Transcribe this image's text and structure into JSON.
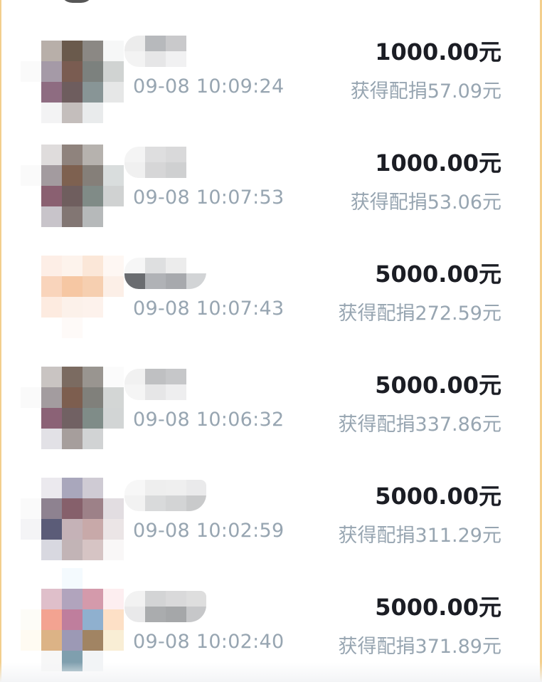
{
  "donations": [
    {
      "time": "09-08 10:09:24",
      "amount": "1000.00元",
      "match": "获得配捐57.09元",
      "avatar_colors": [
        "#ffffff",
        "#ffffff",
        "#ffffff",
        "#ffffff",
        "#ffffff",
        "#ffffff",
        "#b8afa9",
        "#6a5a4c",
        "#8b8884",
        "#f6f7f7",
        "#fafafa",
        "#a59aa7",
        "#7a5c51",
        "#7c817e",
        "#d0d3d2",
        "#ffffff",
        "#8e6c81",
        "#6e5d5e",
        "#889596",
        "#e6e7e7",
        "#ffffff",
        "#f3f3f4",
        "#c4bebc",
        "#e9ebec",
        "#ffffff"
      ],
      "name_colors": [
        "#ececec",
        "#b7b9bc",
        "#c9c9cb",
        "#ffffff",
        "#f3f3f3",
        "#e6e6e7",
        "#f1f1f2",
        "#ffffff"
      ]
    },
    {
      "time": "09-08 10:07:53",
      "amount": "1000.00元",
      "match": "获得配捐53.06元",
      "avatar_colors": [
        "#ffffff",
        "#ffffff",
        "#ffffff",
        "#ffffff",
        "#ffffff",
        "#ffffff",
        "#dfdcdc",
        "#8f837d",
        "#b6b2ae",
        "#ffffff",
        "#fafafa",
        "#a39b9f",
        "#7e6150",
        "#857f79",
        "#d9dddd",
        "#ffffff",
        "#8a6071",
        "#6f5e5e",
        "#808b87",
        "#d0d2d2",
        "#ffffff",
        "#c8c4ca",
        "#827673",
        "#b6b9ba",
        "#ffffff"
      ],
      "name_colors": [
        "#f4f4f4",
        "#dededf",
        "#d9d9da",
        "#ffffff",
        "#f0f0f0",
        "#d6d6d7",
        "#cfd0d1",
        "#ffffff"
      ]
    },
    {
      "time": "09-08 10:07:43",
      "amount": "5000.00元",
      "match": "获得配捐272.59元",
      "avatar_colors": [
        "#ffffff",
        "#ffffff",
        "#ffffff",
        "#ffffff",
        "#ffffff",
        "#ffffff",
        "#fdeee6",
        "#fdf3ec",
        "#fbe7d8",
        "#fef7f3",
        "#ffffff",
        "#f9d4bb",
        "#f6c7a3",
        "#f6cfb0",
        "#fcefe7",
        "#ffffff",
        "#fdebe0",
        "#fcf1ea",
        "#fdf2ec",
        "#ffffff",
        "#ffffff",
        "#ffffff",
        "#fefaf8",
        "#ffffff",
        "#ffffff"
      ],
      "name_colors": [
        "#f6f6f6",
        "#dedfe0",
        "#ececec",
        "#ffffff",
        "#6a6c70",
        "#b0b2b6",
        "#a7a9ad",
        "#d2d4d6"
      ]
    },
    {
      "time": "09-08 10:06:32",
      "amount": "5000.00元",
      "match": "获得配捐337.86元",
      "avatar_colors": [
        "#ffffff",
        "#ffffff",
        "#ffffff",
        "#ffffff",
        "#ffffff",
        "#ffffff",
        "#c9c4c2",
        "#7b6b61",
        "#999590",
        "#fbfbfb",
        "#fafafa",
        "#a39c9f",
        "#7d5e4f",
        "#80807b",
        "#d3d6d5",
        "#ffffff",
        "#8b6276",
        "#716163",
        "#7f8c88",
        "#d2d5d5",
        "#ffffff",
        "#e2e1e6",
        "#a69e9c",
        "#d1d3d4",
        "#ffffff"
      ],
      "name_colors": [
        "#f1f1f1",
        "#bfc0c2",
        "#c6c7c9",
        "#ffffff",
        "#f5f5f5",
        "#e6e6e7",
        "#eeeeef",
        "#ffffff"
      ]
    },
    {
      "time": "09-08 10:02:59",
      "amount": "5000.00元",
      "match": "获得配捐311.29元",
      "avatar_colors": [
        "#ffffff",
        "#ffffff",
        "#ffffff",
        "#ffffff",
        "#ffffff",
        "#ffffff",
        "#ebe9ee",
        "#a9a7bc",
        "#cfcbd4",
        "#ffffff",
        "#fafafa",
        "#8e8290",
        "#86606b",
        "#9d8188",
        "#e2dde1",
        "#f4f4f6",
        "#5b5c78",
        "#c5b2b7",
        "#c8a9a9",
        "#ebe5e6",
        "#ffffff",
        "#d8d8e0",
        "#c2b4b6",
        "#d6c4c4",
        "#f9f7f7"
      ],
      "name_colors": [
        "#f7f7f7",
        "#eeeeee",
        "#efefef",
        "#eaeaeb",
        "#f2f2f2",
        "#d9dadb",
        "#d3d4d5",
        "#c9cacb"
      ]
    },
    {
      "time": "09-08 10:02:40",
      "amount": "5000.00元",
      "match": "获得配捐371.89元",
      "avatar_colors": [
        "#ffffff",
        "#ffffff",
        "#f4fafe",
        "#ffffff",
        "#ffffff",
        "#ffffff",
        "#dfbfca",
        "#b1a4bd",
        "#d49aab",
        "#fdeef0",
        "#fdfcf7",
        "#f3a391",
        "#bf7e9d",
        "#8fb0cf",
        "#fde0c6",
        "#fffbf2",
        "#dcb386",
        "#9c99b5",
        "#a18463",
        "#f9eed5",
        "#ffffff",
        "#f7f7f7",
        "#7f9fae",
        "#f2f4f6",
        "#ffffff"
      ],
      "name_colors": [
        "#f2f2f2",
        "#d3d4d5",
        "#d9d9da",
        "#dedede",
        "#e9e9ea",
        "#aaacae",
        "#a5a7a9",
        "#c6c7c9"
      ]
    }
  ]
}
